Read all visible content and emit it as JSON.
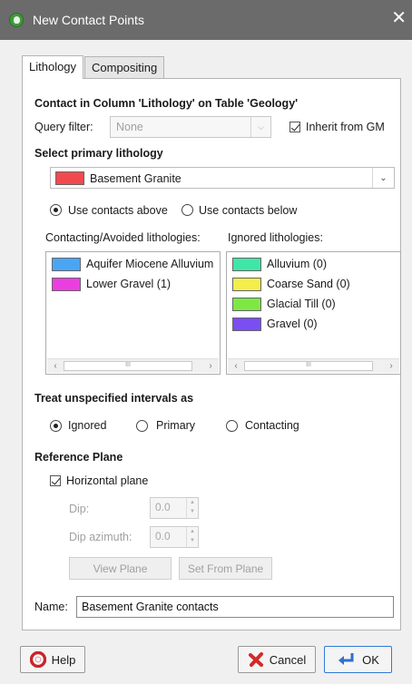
{
  "window": {
    "title": "New Contact Points",
    "close_glyph": "✕"
  },
  "tabs": [
    {
      "label": "Lithology",
      "active": true
    },
    {
      "label": "Compositing",
      "active": false
    }
  ],
  "contact_header": "Contact in Column 'Lithology' on Table 'Geology'",
  "query_filter": {
    "label": "Query filter:",
    "value": "None"
  },
  "inherit_from_gm": {
    "label": "Inherit from GM",
    "checked": true
  },
  "primary": {
    "heading": "Select primary lithology",
    "value": "Basement Granite",
    "color": "#f04a4f"
  },
  "contact_direction": {
    "above": {
      "label": "Use contacts above",
      "selected": true
    },
    "below": {
      "label": "Use contacts below",
      "selected": false
    }
  },
  "contacting_list": {
    "heading": "Contacting/Avoided lithologies:",
    "items": [
      {
        "label": "Aquifer Miocene Alluvium",
        "color": "#4aa6f5"
      },
      {
        "label": "Lower Gravel (1)",
        "color": "#ec3ee0"
      }
    ]
  },
  "ignored_list": {
    "heading": "Ignored lithologies:",
    "items": [
      {
        "label": "Alluvium (0)",
        "color": "#3fe6a8"
      },
      {
        "label": "Coarse Sand (0)",
        "color": "#f3ee4a"
      },
      {
        "label": "Glacial Till (0)",
        "color": "#7ee843"
      },
      {
        "label": "Gravel (0)",
        "color": "#7a4ef2"
      }
    ]
  },
  "unspecified": {
    "heading": "Treat unspecified intervals as",
    "options": [
      {
        "label": "Ignored",
        "selected": true
      },
      {
        "label": "Primary",
        "selected": false
      },
      {
        "label": "Contacting",
        "selected": false
      }
    ]
  },
  "reference_plane": {
    "heading": "Reference Plane",
    "horizontal": {
      "label": "Horizontal plane",
      "checked": true
    },
    "dip": {
      "label": "Dip:",
      "value": "0.0"
    },
    "dip_azimuth": {
      "label": "Dip azimuth:",
      "value": "0.0"
    },
    "view_plane_label": "View Plane",
    "set_from_plane_label": "Set From Plane"
  },
  "name_field": {
    "label": "Name:",
    "value": "Basement Granite contacts"
  },
  "buttons": {
    "help": "Help",
    "cancel": "Cancel",
    "ok": "OK"
  },
  "scroll_grip": "III"
}
